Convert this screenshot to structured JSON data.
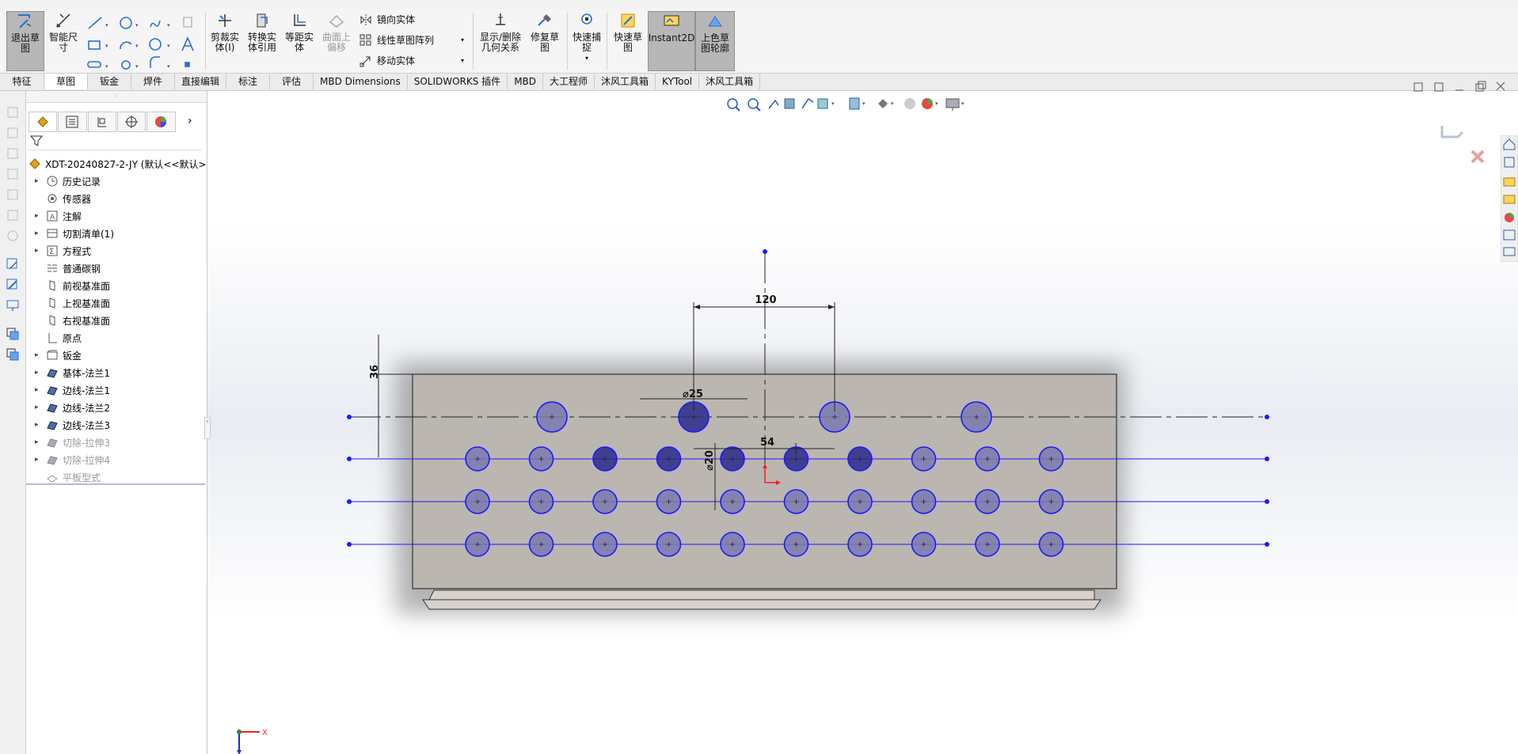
{
  "ribbon": {
    "exit_sketch": "退出草\n图",
    "smart_dim": "智能尺\n寸",
    "trim": "剪裁实\n体(I)",
    "convert": "转换实\n体引用",
    "offset": "等距实\n体",
    "surface_offset": "曲面上\n偏移",
    "mirror": "镜向实体",
    "linear_pattern": "线性草图阵列",
    "move": "移动实体",
    "show_delete_rel": "显示/删除\n几何关系",
    "repair": "修复草\n图",
    "quick_snap": "快速捕\n捉",
    "rapid_sketch": "快速草\n图",
    "instant2d": "Instant2D",
    "shaded_contours": "上色草\n图轮廓"
  },
  "tabs": [
    "特征",
    "草图",
    "钣金",
    "焊件",
    "直接编辑",
    "标注",
    "评估",
    "MBD Dimensions",
    "SOLIDWORKS 插件",
    "MBD",
    "大工程师",
    "沐风工具箱",
    "KYTool",
    "沐风工具箱"
  ],
  "active_tab_index": 1,
  "tree": {
    "root": "XDT-20240827-2-JY  (默认<<默认>",
    "items": [
      {
        "label": "历史记录",
        "expandable": true,
        "grey": false,
        "icon": "history-icon"
      },
      {
        "label": "传感器",
        "expandable": false,
        "grey": false,
        "icon": "sensor-icon"
      },
      {
        "label": "注解",
        "expandable": true,
        "grey": false,
        "icon": "annotation-icon"
      },
      {
        "label": "切割清单(1)",
        "expandable": true,
        "grey": false,
        "icon": "cutlist-icon"
      },
      {
        "label": "方程式",
        "expandable": true,
        "grey": false,
        "icon": "equation-icon"
      },
      {
        "label": "普通碳钢",
        "expandable": false,
        "grey": false,
        "icon": "material-icon"
      },
      {
        "label": "前视基准面",
        "expandable": false,
        "grey": false,
        "icon": "plane-icon"
      },
      {
        "label": "上视基准面",
        "expandable": false,
        "grey": false,
        "icon": "plane-icon"
      },
      {
        "label": "右视基准面",
        "expandable": false,
        "grey": false,
        "icon": "plane-icon"
      },
      {
        "label": "原点",
        "expandable": false,
        "grey": false,
        "icon": "origin-icon"
      },
      {
        "label": "钣金",
        "expandable": true,
        "grey": false,
        "icon": "sheetmetal-icon"
      },
      {
        "label": "基体-法兰1",
        "expandable": true,
        "grey": false,
        "icon": "base-flange-icon"
      },
      {
        "label": "边线-法兰1",
        "expandable": true,
        "grey": false,
        "icon": "edge-flange-icon"
      },
      {
        "label": "边线-法兰2",
        "expandable": true,
        "grey": false,
        "icon": "edge-flange-icon"
      },
      {
        "label": "边线-法兰3",
        "expandable": true,
        "grey": false,
        "icon": "edge-flange-icon"
      },
      {
        "label": "切除-拉伸3",
        "expandable": true,
        "grey": true,
        "icon": "cut-extrude-icon"
      },
      {
        "label": "切除-拉伸4",
        "expandable": true,
        "grey": true,
        "icon": "cut-extrude-icon"
      },
      {
        "label": "平板型式",
        "expandable": false,
        "grey": true,
        "icon": "flat-pattern-icon"
      }
    ]
  },
  "sketch": {
    "dim_120": "120",
    "dim_36": "36",
    "dim_d25": "⌀25",
    "dim_54": "54",
    "dim_d20": "⌀20",
    "axis_x": "X",
    "row1_holes": 4,
    "grid_cols": 10,
    "grid_rows": 3
  },
  "colors": {
    "sketch_blue": "#1a1aff",
    "hole_fill": "#7a7ab0",
    "selected_fill": "#2a2a8a",
    "plate": "#bcb6b0"
  }
}
